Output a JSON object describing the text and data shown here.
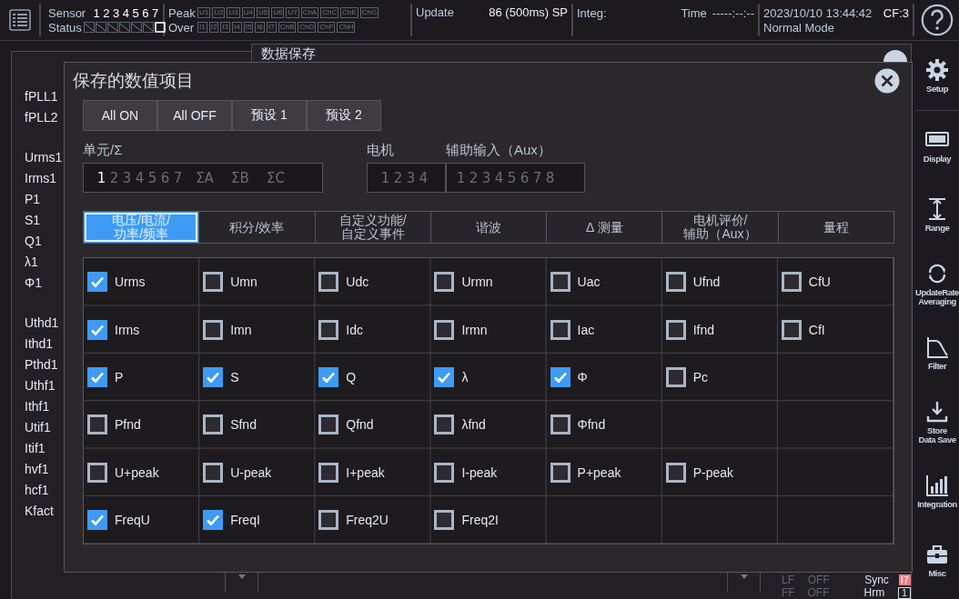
{
  "top_bar": {
    "sensor_label": "Sensor",
    "sensor_numbers": [
      "1",
      "2",
      "3",
      "4",
      "5",
      "6",
      "7"
    ],
    "status_label": "Status",
    "status": [
      {
        "active": false
      },
      {
        "active": false
      },
      {
        "active": false
      },
      {
        "active": false
      },
      {
        "active": false
      },
      {
        "active": false
      },
      {
        "active": true
      }
    ],
    "peak_label": "Peak",
    "peak_flags": [
      "U1",
      "U2",
      "U3",
      "U4",
      "U5",
      "U6",
      "U7",
      "ChA",
      "ChC",
      "ChE",
      "ChG"
    ],
    "over_label": "Over",
    "over_flags": [
      "I1",
      "I2",
      "I3",
      "I4",
      "I5",
      "I6",
      "I7",
      "ChB",
      "ChD",
      "ChF",
      "ChH"
    ],
    "update_label": "Update",
    "update_value": "86 (500ms) SP",
    "integ_label": "Integ:",
    "time_label": "Time",
    "time_value": "-----:--:--",
    "datetime": "2023/10/10 13:44:42",
    "cf": "CF:3",
    "mode": "Normal Mode"
  },
  "sidebar": {
    "items": [
      {
        "label": "Setup"
      },
      {
        "label": "Display"
      },
      {
        "label": "Range"
      },
      {
        "label": "UpdateRate\nAveraging"
      },
      {
        "label": "Filter"
      },
      {
        "label": "Store\nData Save"
      },
      {
        "label": "Integration"
      },
      {
        "label": "Misc"
      }
    ]
  },
  "background_window": {
    "value_groups": [
      [
        "fPLL1",
        "fPLL2"
      ],
      [
        "Urms1",
        "Irms1",
        "P1",
        "S1",
        "Q1",
        "λ1",
        "Φ1"
      ],
      [
        "Uthd1",
        "Ithd1",
        "Pthd1",
        "Uthf1",
        "Ithf1",
        "Utif1",
        "Itif1",
        "hvf1",
        "hcf1",
        "Kfact"
      ]
    ]
  },
  "store_window": {
    "title": "数据保存"
  },
  "dialog": {
    "title": "保存的数值项目",
    "buttons": [
      "All ON",
      "All OFF",
      "预设 1",
      "预设 2"
    ],
    "unit": {
      "label": "单元/Σ",
      "items": [
        {
          "label": "1",
          "selected": true
        },
        {
          "label": "2",
          "selected": false
        },
        {
          "label": "3",
          "selected": false
        },
        {
          "label": "4",
          "selected": false
        },
        {
          "label": "5",
          "selected": false
        },
        {
          "label": "6",
          "selected": false
        },
        {
          "label": "7",
          "selected": false
        },
        {
          "label": "ΣA",
          "selected": false
        },
        {
          "label": "ΣB",
          "selected": false
        },
        {
          "label": "ΣC",
          "selected": false
        }
      ]
    },
    "motor": {
      "label": "电机",
      "items": [
        {
          "label": "1",
          "selected": false
        },
        {
          "label": "2",
          "selected": false
        },
        {
          "label": "3",
          "selected": false
        },
        {
          "label": "4",
          "selected": false
        }
      ]
    },
    "aux": {
      "label": "辅助输入（Aux）",
      "items": [
        {
          "label": "1",
          "selected": false
        },
        {
          "label": "2",
          "selected": false
        },
        {
          "label": "3",
          "selected": false
        },
        {
          "label": "4",
          "selected": false
        },
        {
          "label": "5",
          "selected": false
        },
        {
          "label": "6",
          "selected": false
        },
        {
          "label": "7",
          "selected": false
        },
        {
          "label": "8",
          "selected": false
        }
      ]
    },
    "tabs": [
      {
        "label": "电压/电流/\n功率/频率",
        "selected": true
      },
      {
        "label": "积分/效率",
        "selected": false
      },
      {
        "label": "自定义功能/\n自定义事件",
        "selected": false
      },
      {
        "label": "谐波",
        "selected": false
      },
      {
        "label": "Δ 测量",
        "selected": false
      },
      {
        "label": "电机评价/\n辅助（Aux）",
        "selected": false
      },
      {
        "label": "量程",
        "selected": false
      }
    ],
    "grid": [
      [
        {
          "label": "Urms",
          "checked": true
        },
        {
          "label": "Umn",
          "checked": false
        },
        {
          "label": "Udc",
          "checked": false
        },
        {
          "label": "Urmn",
          "checked": false
        },
        {
          "label": "Uac",
          "checked": false
        },
        {
          "label": "Ufnd",
          "checked": false
        },
        {
          "label": "CfU",
          "checked": false
        }
      ],
      [
        {
          "label": "Irms",
          "checked": true
        },
        {
          "label": "Imn",
          "checked": false
        },
        {
          "label": "Idc",
          "checked": false
        },
        {
          "label": "Irmn",
          "checked": false
        },
        {
          "label": "Iac",
          "checked": false
        },
        {
          "label": "Ifnd",
          "checked": false
        },
        {
          "label": "CfI",
          "checked": false
        }
      ],
      [
        {
          "label": "P",
          "checked": true
        },
        {
          "label": "S",
          "checked": true
        },
        {
          "label": "Q",
          "checked": true
        },
        {
          "label": "λ",
          "checked": true
        },
        {
          "label": "Φ",
          "checked": true
        },
        {
          "label": "Pc",
          "checked": false
        }
      ],
      [
        {
          "label": "Pfnd",
          "checked": false
        },
        {
          "label": "Sfnd",
          "checked": false
        },
        {
          "label": "Qfnd",
          "checked": false
        },
        {
          "label": "λfnd",
          "checked": false
        },
        {
          "label": "Φfnd",
          "checked": false
        }
      ],
      [
        {
          "label": "U+peak",
          "checked": false
        },
        {
          "label": "U-peak",
          "checked": false
        },
        {
          "label": "I+peak",
          "checked": false
        },
        {
          "label": "I-peak",
          "checked": false
        },
        {
          "label": "P+peak",
          "checked": false
        },
        {
          "label": "P-peak",
          "checked": false
        }
      ],
      [
        {
          "label": "FreqU",
          "checked": true
        },
        {
          "label": "FreqI",
          "checked": true
        },
        {
          "label": "Freq2U",
          "checked": false
        },
        {
          "label": "Freq2I",
          "checked": false
        }
      ]
    ]
  },
  "status_area": {
    "lf_label": "LF",
    "lf_value": "OFF",
    "ff_label": "FF",
    "ff_value": "OFF",
    "sync_label": "Sync",
    "sync_value": "I7",
    "hrm_label": "Hrm",
    "hrm_value": "1"
  }
}
